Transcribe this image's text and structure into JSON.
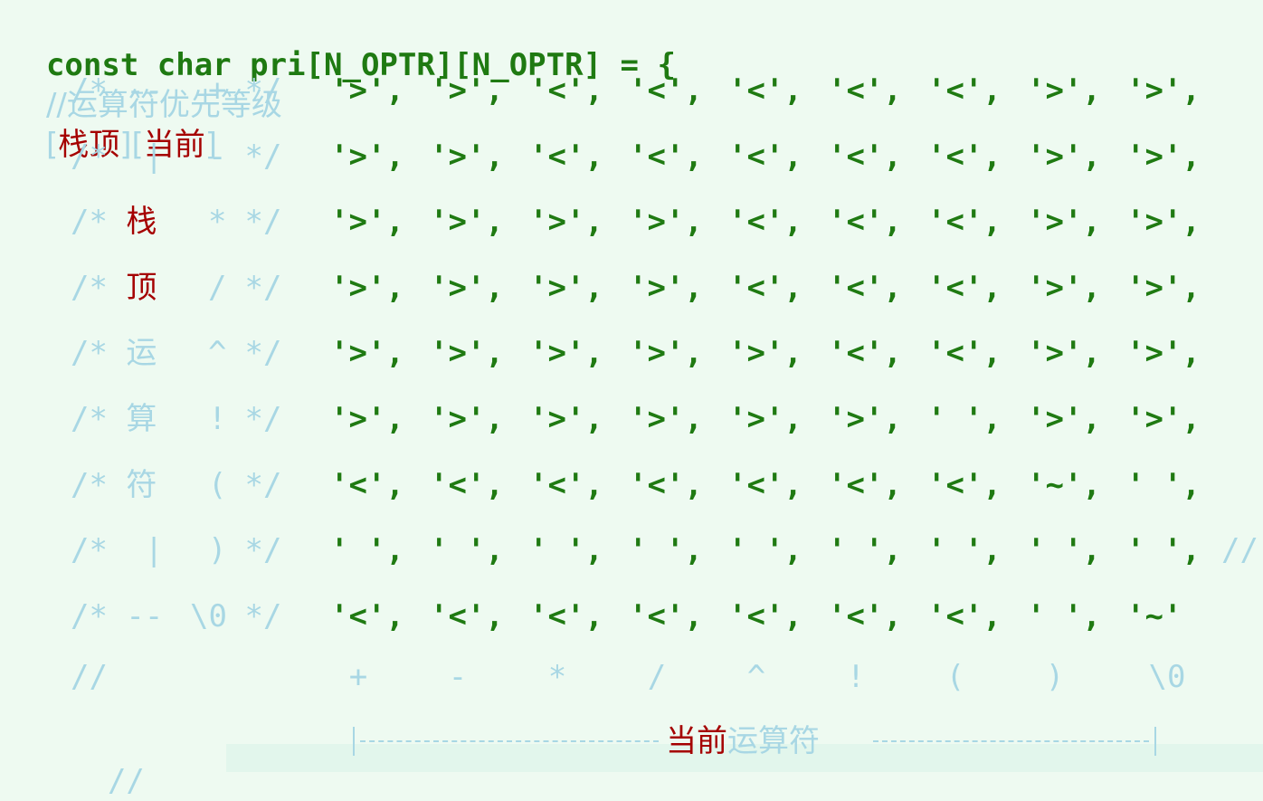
{
  "header": {
    "code": "const char pri[N_OPTR][N_OPTR] = {",
    "comment": "//运算符优先等级 ",
    "bracket_open_1": "[",
    "top_label": "栈顶",
    "bracket_close_1": "]",
    "bracket_open_2": "[",
    "current_label": "当前",
    "bracket_close_2": "]"
  },
  "rows": [
    {
      "prefix": "/* ",
      "side": "--",
      "side_red": false,
      "op": "+",
      "values": [
        "'>',",
        "'>',",
        "'<',",
        "'<',",
        "'<',",
        "'<',",
        "'<',",
        "'>',",
        "'>',"
      ],
      "trailing": ""
    },
    {
      "prefix": "/* ",
      "side": " |",
      "side_red": false,
      "op": "-",
      "values": [
        "'>',",
        "'>',",
        "'<',",
        "'<',",
        "'<',",
        "'<',",
        "'<',",
        "'>',",
        "'>',"
      ],
      "trailing": ""
    },
    {
      "prefix": "/* ",
      "side": "栈",
      "side_red": true,
      "op": "*",
      "values": [
        "'>',",
        "'>',",
        "'>',",
        "'>',",
        "'<',",
        "'<',",
        "'<',",
        "'>',",
        "'>',"
      ],
      "trailing": ""
    },
    {
      "prefix": "/* ",
      "side": "顶",
      "side_red": true,
      "op": "/",
      "values": [
        "'>',",
        "'>',",
        "'>',",
        "'>',",
        "'<',",
        "'<',",
        "'<',",
        "'>',",
        "'>',"
      ],
      "trailing": ""
    },
    {
      "prefix": "/* ",
      "side": "运",
      "side_red": false,
      "op": "^",
      "values": [
        "'>',",
        "'>',",
        "'>',",
        "'>',",
        "'>',",
        "'<',",
        "'<',",
        "'>',",
        "'>',"
      ],
      "trailing": ""
    },
    {
      "prefix": "/* ",
      "side": "算",
      "side_red": false,
      "op": "!",
      "values": [
        "'>',",
        "'>',",
        "'>',",
        "'>',",
        "'>',",
        "'>',",
        "' ',",
        "'>',",
        "'>',"
      ],
      "trailing": ""
    },
    {
      "prefix": "/* ",
      "side": "符",
      "side_red": false,
      "op": "(",
      "values": [
        "'<',",
        "'<',",
        "'<',",
        "'<',",
        "'<',",
        "'<',",
        "'<',",
        "'~',",
        "' ',"
      ],
      "trailing": ""
    },
    {
      "prefix": "/* ",
      "side": " |",
      "side_red": false,
      "op": ")",
      "values": [
        "' ',",
        "' ',",
        "' ',",
        "' ',",
        "' ',",
        "' ',",
        "' ',",
        "' ',",
        "' ',"
      ],
      "trailing": "//"
    },
    {
      "prefix": "/* ",
      "side": "--",
      "side_red": false,
      "op": "\\0",
      "values": [
        "'<',",
        "'<',",
        "'<',",
        "'<',",
        "'<',",
        "'<',",
        "'<',",
        "' ',",
        "'~'"
      ],
      "trailing": ""
    }
  ],
  "comment_suffix": " */",
  "column_labels_prefix": "//",
  "column_labels": [
    "+",
    "-",
    "*",
    "/",
    "^",
    "!",
    "(",
    ")",
    "\\0"
  ],
  "footer": {
    "prefix": "//",
    "current_label": "当前",
    "operator_label": "运算符"
  }
}
